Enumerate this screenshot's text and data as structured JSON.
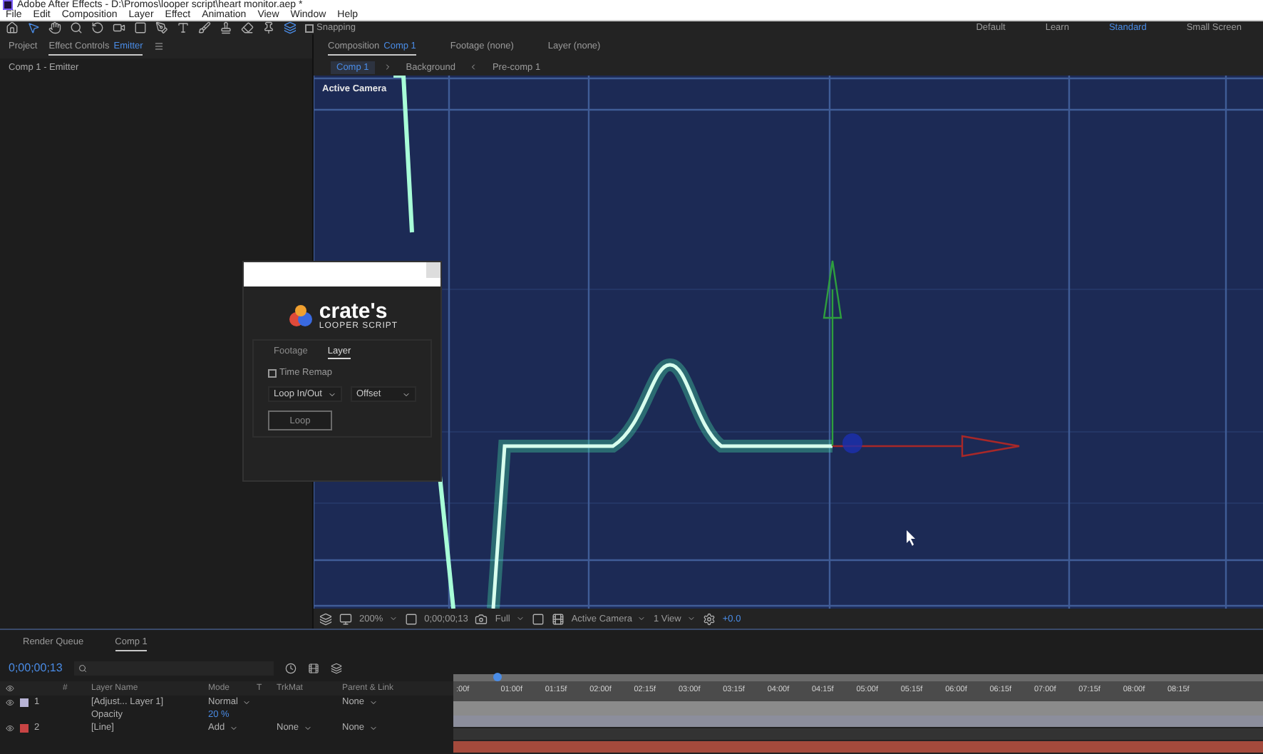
{
  "window": {
    "title": "Adobe After Effects - D:\\Promos\\looper script\\heart monitor.aep *"
  },
  "menu": [
    "File",
    "Edit",
    "Composition",
    "Layer",
    "Effect",
    "Animation",
    "View",
    "Window",
    "Help"
  ],
  "snapping": {
    "label": "Snapping",
    "checked": false
  },
  "workspaces": [
    {
      "label": "Default",
      "selected": false
    },
    {
      "label": "Learn",
      "selected": false
    },
    {
      "label": "Standard",
      "selected": true
    },
    {
      "label": "Small Screen",
      "selected": false
    }
  ],
  "left_panel": {
    "tabs": [
      {
        "label": "Project",
        "selected": false
      },
      {
        "label": "Effect Controls",
        "target": "Emitter",
        "selected": true
      }
    ],
    "subtitle": "Comp 1 - Emitter"
  },
  "composition_panel": {
    "tabs": [
      {
        "label": "Composition",
        "target": "Comp 1",
        "selected": true
      },
      {
        "label": "Footage (none)",
        "selected": false
      },
      {
        "label": "Layer (none)",
        "selected": false
      }
    ],
    "breadcrumb": [
      {
        "label": "Comp 1",
        "selected": true
      },
      {
        "label": "Background",
        "selected": false
      },
      {
        "label": "Pre-comp 1",
        "selected": false
      }
    ],
    "viewer_label": "Active Camera",
    "toolbar": {
      "zoom": "200%",
      "timecode": "0;00;00;13",
      "resolution": "Full",
      "camera": "Active Camera",
      "views": "1 View",
      "exposure": "+0.0"
    }
  },
  "looper_dialog": {
    "logo_title": "crate's",
    "logo_subtitle": "LOOPER SCRIPT",
    "tabs": [
      {
        "label": "Footage",
        "selected": false
      },
      {
        "label": "Layer",
        "selected": true
      }
    ],
    "time_remap": {
      "label": "Time Remap",
      "checked": false
    },
    "loop_mode": "Loop In/Out",
    "loop_type": "Offset",
    "button": "Loop"
  },
  "timeline": {
    "tabs": [
      {
        "label": "Render Queue",
        "selected": false
      },
      {
        "label": "Comp 1",
        "selected": true
      }
    ],
    "timecode": "0;00;00;13",
    "columns": [
      "#",
      "Layer Name",
      "Mode",
      "T",
      "TrkMat",
      "Parent & Link"
    ],
    "layers": [
      {
        "number": "1",
        "name": "[Adjust... Layer 1]",
        "mode": "Normal",
        "parent": "None",
        "color": "#b8b4d6",
        "property": {
          "name": "Opacity",
          "value": "20 %"
        }
      },
      {
        "number": "2",
        "name": "[Line]",
        "mode": "Add",
        "trkmat": "None",
        "parent": "None",
        "color": "#c84444"
      }
    ],
    "ruler": [
      ":00f",
      "01:00f",
      "01:15f",
      "02:00f",
      "02:15f",
      "03:00f",
      "03:15f",
      "04:00f",
      "04:15f",
      "05:00f",
      "05:15f",
      "06:00f",
      "06:15f",
      "07:00f",
      "07:15f",
      "08:00f",
      "08:15f"
    ]
  }
}
